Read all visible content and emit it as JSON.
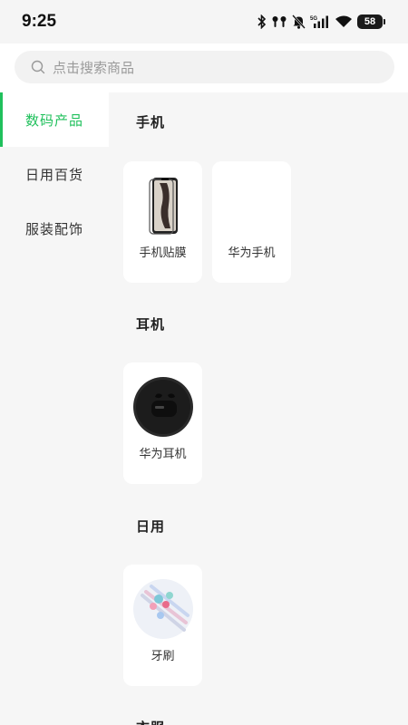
{
  "status_bar": {
    "time": "9:25",
    "battery": "58",
    "network": "5G",
    "icons": [
      "bluetooth-icon",
      "earbuds-icon",
      "mute-bell-icon",
      "signal-icon",
      "wifi-icon",
      "battery-icon"
    ]
  },
  "search": {
    "placeholder": "点击搜索商品",
    "icon": "search-icon"
  },
  "sidebar": {
    "items": [
      {
        "label": "数码产品",
        "active": true
      },
      {
        "label": "日用百货",
        "active": false
      },
      {
        "label": "服装配饰",
        "active": false
      }
    ]
  },
  "sections": [
    {
      "title": "手机",
      "items": [
        {
          "label": "手机贴膜"
        },
        {
          "label": "华为手机"
        }
      ]
    },
    {
      "title": "耳机",
      "items": [
        {
          "label": "华为耳机"
        }
      ]
    },
    {
      "title": "日用",
      "items": [
        {
          "label": "牙刷"
        }
      ]
    },
    {
      "title": "衣服"
    }
  ],
  "colors": {
    "accent": "#20c05c",
    "background": "#f6f6f6",
    "card": "#ffffff"
  }
}
